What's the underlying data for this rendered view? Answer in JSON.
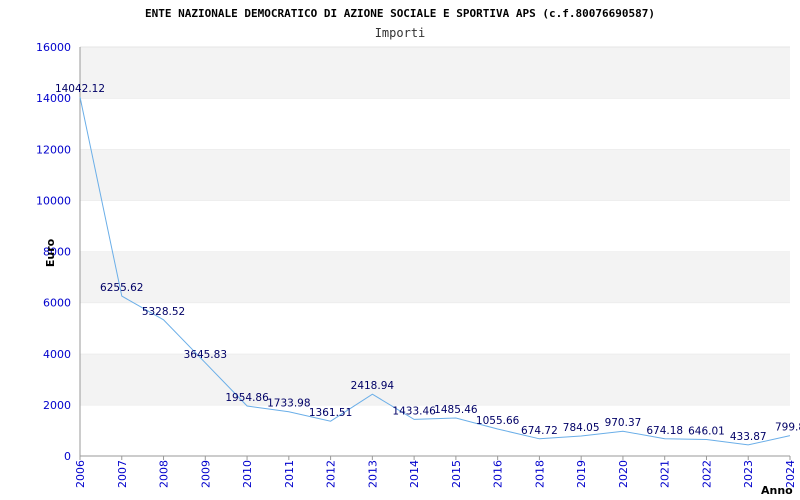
{
  "chart_data": {
    "type": "line",
    "title": "ENTE NAZIONALE DEMOCRATICO DI AZIONE SOCIALE E SPORTIVA APS (c.f.80076690587)",
    "subtitle": "Importi",
    "xlabel": "Anno",
    "ylabel": "Euro",
    "categories": [
      "2006",
      "2007",
      "2008",
      "2009",
      "2010",
      "2011",
      "2012",
      "2013",
      "2014",
      "2015",
      "2016",
      "2018",
      "2019",
      "2020",
      "2021",
      "2022",
      "2023",
      "2024"
    ],
    "values": [
      14042.12,
      6255.62,
      5328.52,
      3645.83,
      1954.86,
      1733.98,
      1361.51,
      2418.94,
      1433.46,
      1485.46,
      1055.66,
      674.72,
      784.05,
      970.37,
      674.18,
      646.01,
      433.87,
      799.8
    ],
    "value_labels": [
      "14042.12",
      "6255.62",
      "5328.52",
      "3645.83",
      "1954.86",
      "1733.98",
      "1361.51",
      "2418.94",
      "1433.46",
      "1485.46",
      "1055.66",
      "674.72",
      "784.05",
      "970.37",
      "674.18",
      "646.01",
      "433.87",
      "799.8"
    ],
    "ylim": [
      0,
      16000
    ],
    "yticks": [
      "0",
      "2000",
      "4000",
      "6000",
      "8000",
      "10000",
      "12000",
      "14000",
      "16000"
    ],
    "grid": "horizontal alternating bands",
    "colors": {
      "line": "#6aaee8",
      "band": "#f3f3f3",
      "tick_text": "#0000cc",
      "label_text": "#000066",
      "axis": "#999999"
    }
  }
}
